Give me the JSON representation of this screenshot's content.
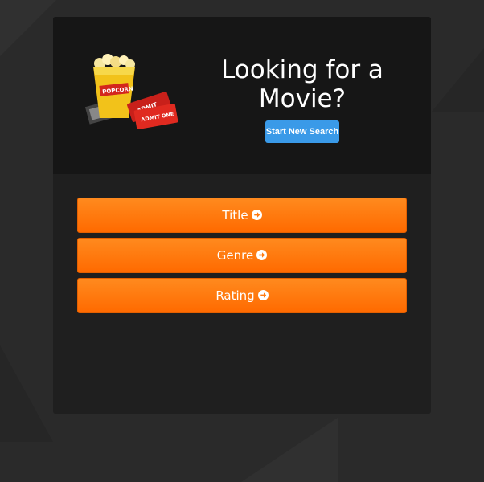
{
  "header": {
    "headline": "Looking for a Movie?",
    "new_search_label": "Start New Search",
    "logo": {
      "icon": "popcorn-tickets-logo",
      "popcorn_text": "POPCORN",
      "ticket_text_1": "ADMIT",
      "ticket_text_2": "ADMIT ONE"
    }
  },
  "options": [
    {
      "label": "Title",
      "icon": "arrow-circle-right-icon"
    },
    {
      "label": "Genre",
      "icon": "arrow-circle-right-icon"
    },
    {
      "label": "Rating",
      "icon": "arrow-circle-right-icon"
    }
  ],
  "colors": {
    "page_bg": "#2a2a2a",
    "card_bg": "#1f1f1f",
    "header_bg": "#161616",
    "primary_button": "#3a9ae8",
    "option_button": "#ff7a10"
  }
}
